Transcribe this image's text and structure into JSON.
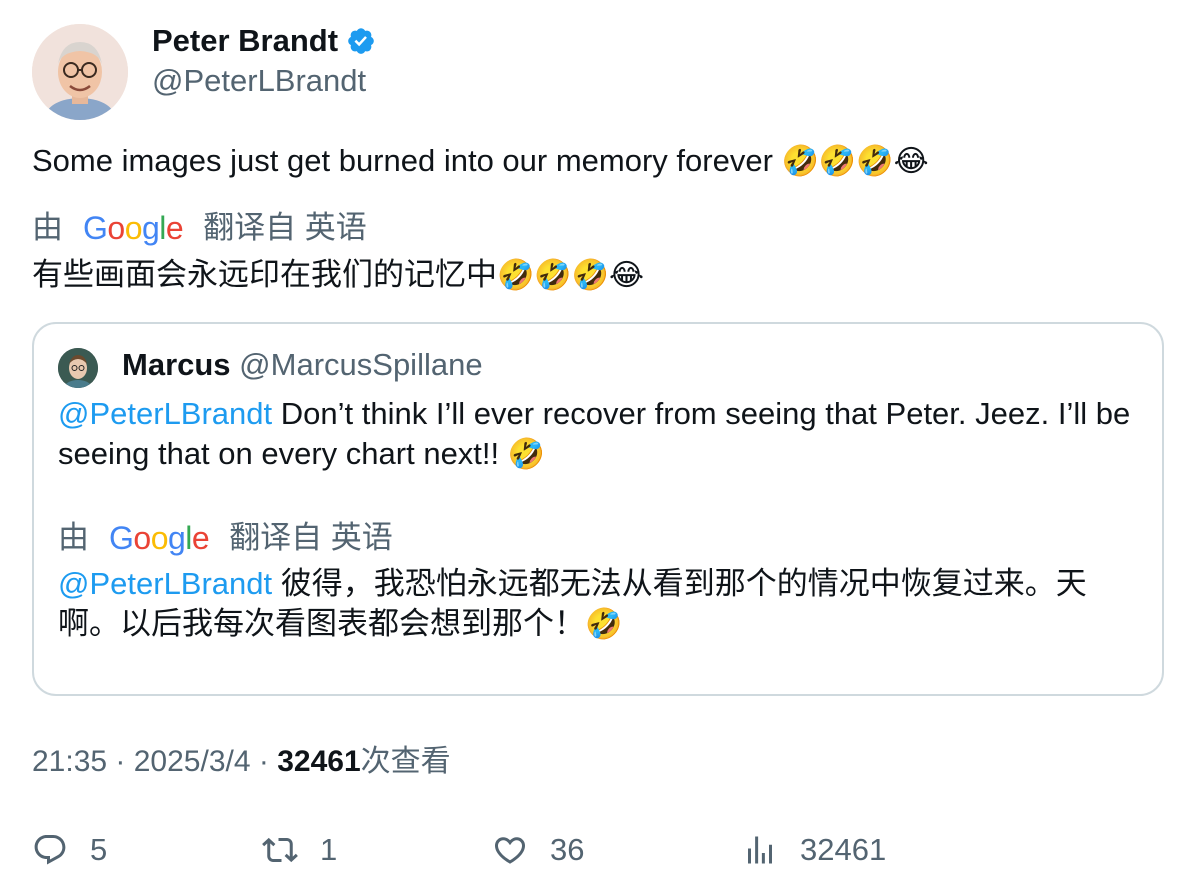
{
  "author": {
    "display_name": "Peter Brandt",
    "handle": "@PeterLBrandt",
    "verified_color": "#1d9bf0"
  },
  "tweet": {
    "text": "Some images just get burned into our memory forever",
    "emojis": "🤣🤣🤣😂",
    "translate_prefix": "由",
    "translate_brand": "Google",
    "translate_suffix": "翻译自 英语",
    "translated_text": "有些画面会永远印在我们的记忆中",
    "translated_emojis": "🤣🤣🤣😂"
  },
  "quote": {
    "display_name": "Marcus",
    "handle": "@MarcusSpillane",
    "mention": "@PeterLBrandt",
    "text": "Don’t think I’ll ever recover from seeing that Peter. Jeez. I’ll be seeing that on every chart next!!",
    "emoji": "🤣",
    "translate_prefix": "由",
    "translate_brand": "Google",
    "translate_suffix": "翻译自 英语",
    "translated_mention": "@PeterLBrandt",
    "translated_text": "彼得，我恐怕永远都无法从看到那个的情况中恢复过来。天啊。以后我每次看图表都会想到那个！",
    "translated_emoji": "🤣"
  },
  "meta": {
    "time": "21:35",
    "separator": " · ",
    "date": "2025/3/4",
    "views_count": "32461",
    "views_label": "次查看"
  },
  "actions": {
    "replies": "5",
    "reposts": "1",
    "likes": "36",
    "views": "32461"
  },
  "colors": {
    "link": "#1d9bf0",
    "secondary_text": "#536471",
    "primary_text": "#0f1419",
    "border": "#cfd9de"
  }
}
